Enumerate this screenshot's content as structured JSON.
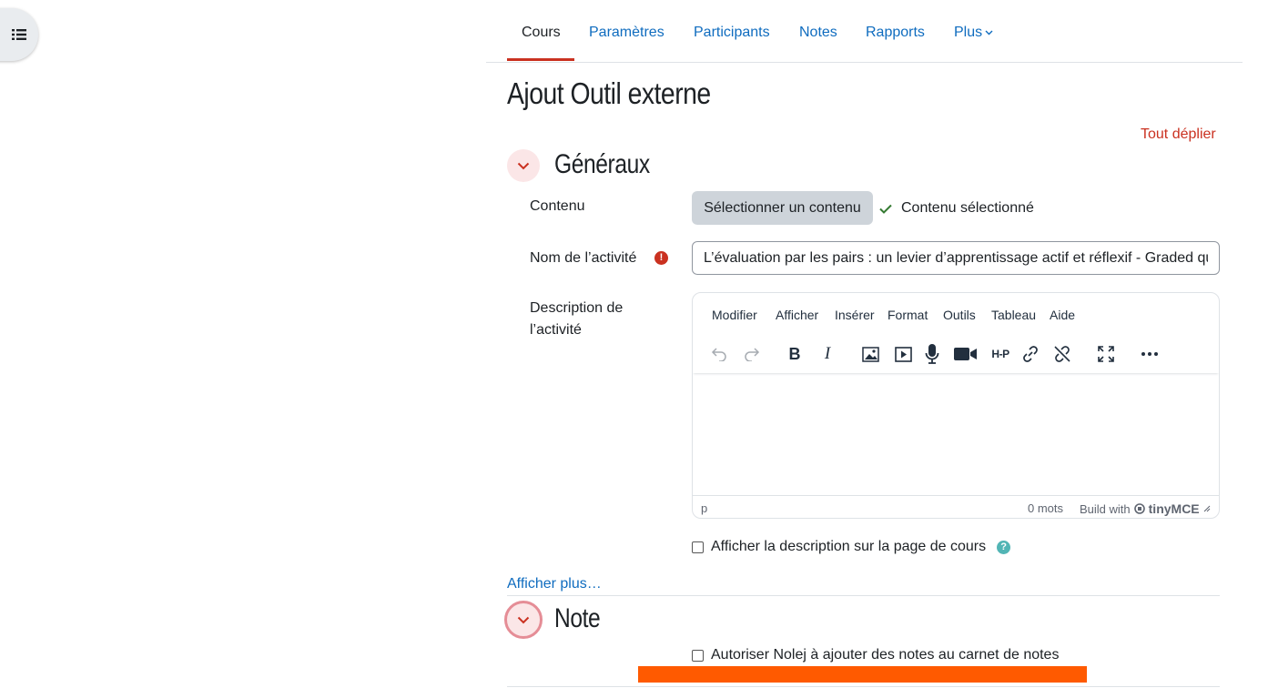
{
  "nav": {
    "tabs": [
      {
        "label": "Cours"
      },
      {
        "label": "Paramètres"
      },
      {
        "label": "Participants"
      },
      {
        "label": "Notes"
      },
      {
        "label": "Rapports"
      },
      {
        "label": "Plus"
      }
    ],
    "active_tab": "Cours"
  },
  "page": {
    "title": "Ajout Outil externe",
    "expand_all": "Tout déplier"
  },
  "general": {
    "section_title": "Généraux",
    "content_label": "Contenu",
    "select_content_button": "Sélectionner un contenu",
    "content_selected": "Contenu sélectionné",
    "activity_name_label": "Nom de l’activité",
    "activity_name_value": "L’évaluation par les pairs : un levier d’apprentissage actif et réflexif - Graded quiz",
    "description_label": "Description de l’activité",
    "show_description": "Afficher la description sur la page de cours",
    "show_more": "Afficher plus…"
  },
  "editor": {
    "menus": [
      "Modifier",
      "Afficher",
      "Insérer",
      "Format",
      "Outils",
      "Tableau",
      "Aide"
    ],
    "status_path": "p",
    "word_count": "0 mots",
    "build_with": "Build with",
    "brand": "tinyMCE",
    "toolbar_icons": [
      "undo-icon",
      "redo-icon",
      "bold-icon",
      "italic-icon",
      "image-icon",
      "media-icon",
      "microphone-icon",
      "video-icon",
      "h5p-icon",
      "link-icon",
      "unlink-icon",
      "fullscreen-icon",
      "more-icon"
    ]
  },
  "grade": {
    "section_title": "Note",
    "allow_grades": "Autoriser Nolej à ajouter des notes au carnet de notes"
  },
  "colors": {
    "primary": "#0f6cbf",
    "accent": "#ca3120",
    "success": "#357a32",
    "highlight": "#ff5a00"
  }
}
